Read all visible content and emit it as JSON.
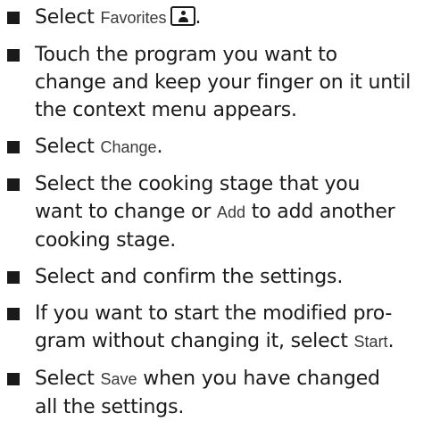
{
  "steps": [
    {
      "before": "Select ",
      "ui": "Favorites",
      "after": "."
    },
    {
      "line1": "Touch the program you want to",
      "line2": "change and keep your finger on it until",
      "line3": "the context menu appears."
    },
    {
      "before": "Select ",
      "ui": "Change",
      "after": "."
    },
    {
      "line1": "Select the cooking stage that you",
      "line2_before": "want to change or ",
      "ui": "Add",
      "line2_after": " to add another",
      "line3": "cooking stage."
    },
    {
      "text": "Select and confirm the settings."
    },
    {
      "line1": "If you want to start the modified pro-",
      "line2_before": "gram without changing it, select ",
      "ui": "Start",
      "line2_after": "."
    },
    {
      "before": "Select ",
      "ui": "Save",
      "line1_after": " when you have changed",
      "line2": "all the settings."
    }
  ]
}
